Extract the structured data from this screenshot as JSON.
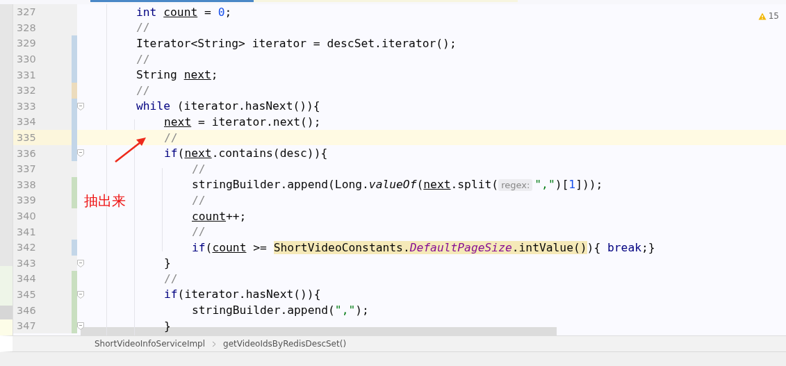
{
  "inspection": {
    "warnings": "15"
  },
  "lines": [
    {
      "number": "327",
      "fold": false,
      "current": false,
      "tokens": [
        {
          "kind": "keyword",
          "text": "int "
        },
        {
          "kind": "local",
          "text": "count"
        },
        {
          "kind": "plain",
          "text": " = "
        },
        {
          "kind": "number",
          "text": "0"
        },
        {
          "kind": "plain",
          "text": ";"
        }
      ]
    },
    {
      "number": "328",
      "fold": false,
      "current": false,
      "tokens": [
        {
          "kind": "comment",
          "text": "//"
        }
      ]
    },
    {
      "number": "329",
      "color": "#c3d6e8",
      "fold": false,
      "current": false,
      "tokens": [
        {
          "kind": "plain",
          "text": "Iterator<String> iterator = descSet.iterator();"
        }
      ]
    },
    {
      "number": "330",
      "color": "#c3d6e8",
      "fold": false,
      "current": false,
      "tokens": [
        {
          "kind": "comment",
          "text": "//"
        }
      ]
    },
    {
      "number": "331",
      "color": "#c3d6e8",
      "fold": false,
      "current": false,
      "tokens": [
        {
          "kind": "plain",
          "text": "String "
        },
        {
          "kind": "local",
          "text": "next"
        },
        {
          "kind": "plain",
          "text": ";"
        }
      ]
    },
    {
      "number": "332",
      "color": "#ecdcbd",
      "fold": false,
      "current": false,
      "tokens": [
        {
          "kind": "comment",
          "text": "//"
        }
      ]
    },
    {
      "number": "333",
      "color": "#c3d6e8",
      "fold": true,
      "current": false,
      "tokens": [
        {
          "kind": "keyword",
          "text": "while"
        },
        {
          "kind": "plain",
          "text": " (iterator.hasNext()){"
        }
      ],
      "children": [
        {
          "number": "334",
          "color": "#c3d6e8",
          "fold": false,
          "current": false,
          "tokens": [
            {
              "kind": "local",
              "text": "next"
            },
            {
              "kind": "plain",
              "text": " = iterator.next();"
            }
          ]
        },
        {
          "number": "335",
          "color": "#c3d6e8",
          "fold": false,
          "current": true,
          "tokens": [
            {
              "kind": "comment",
              "text": "//"
            }
          ]
        },
        {
          "number": "336",
          "color": "#c3d6e8",
          "fold": true,
          "current": false,
          "tokens": [
            {
              "kind": "keyword",
              "text": "if"
            },
            {
              "kind": "plain",
              "text": "("
            },
            {
              "kind": "local",
              "text": "next"
            },
            {
              "kind": "plain",
              "text": ".contains(desc)){"
            }
          ],
          "children": [
            {
              "number": "337",
              "fold": false,
              "current": false,
              "tokens": [
                {
                  "kind": "comment",
                  "text": "//"
                }
              ]
            },
            {
              "number": "338",
              "color": "#c9dfc0",
              "fold": false,
              "current": false,
              "tokens": [
                {
                  "kind": "plain",
                  "text": "stringBuilder.append(Long."
                },
                {
                  "kind": "static-method",
                  "text": "valueOf"
                },
                {
                  "kind": "plain",
                  "text": "("
                },
                {
                  "kind": "local",
                  "text": "next"
                },
                {
                  "kind": "plain",
                  "text": ".split("
                },
                {
                  "kind": "hint",
                  "text": "regex:"
                },
                {
                  "kind": "string",
                  "text": "\",\""
                },
                {
                  "kind": "plain",
                  "text": ")["
                },
                {
                  "kind": "number",
                  "text": "1"
                },
                {
                  "kind": "plain",
                  "text": "]));"
                }
              ]
            },
            {
              "number": "339",
              "color": "#c9dfc0",
              "fold": false,
              "current": false,
              "tokens": [
                {
                  "kind": "comment",
                  "text": "//"
                }
              ]
            },
            {
              "number": "340",
              "fold": false,
              "current": false,
              "tokens": [
                {
                  "kind": "local",
                  "text": "count"
                },
                {
                  "kind": "plain",
                  "text": "++;"
                }
              ]
            },
            {
              "number": "341",
              "fold": false,
              "current": false,
              "tokens": [
                {
                  "kind": "comment",
                  "text": "//"
                }
              ]
            },
            {
              "number": "342",
              "color": "#c3d6e8",
              "fold": false,
              "current": false,
              "tokens": [
                {
                  "kind": "keyword",
                  "text": "if"
                },
                {
                  "kind": "plain",
                  "text": "("
                },
                {
                  "kind": "local",
                  "text": "count"
                },
                {
                  "kind": "plain",
                  "text": " >= "
                },
                {
                  "kind": "highlight",
                  "parts": [
                    {
                      "kind": "plain",
                      "text": "ShortVideoConstants."
                    },
                    {
                      "kind": "static-field",
                      "text": "DefaultPageSize"
                    },
                    {
                      "kind": "plain",
                      "text": ".intValue()"
                    }
                  ]
                },
                {
                  "kind": "plain",
                  "text": "){ "
                },
                {
                  "kind": "keyword",
                  "text": "break"
                },
                {
                  "kind": "plain",
                  "text": ";}"
                }
              ]
            }
          ]
        },
        {
          "number": "343",
          "fold": true,
          "current": false,
          "tokens": [
            {
              "kind": "plain",
              "text": "}"
            }
          ]
        },
        {
          "number": "344",
          "color": "#c9dfc0",
          "fold": false,
          "current": false,
          "tokens": [
            {
              "kind": "comment",
              "text": "//"
            }
          ]
        },
        {
          "number": "345",
          "color": "#c9dfc0",
          "fold": true,
          "current": false,
          "tokens": [
            {
              "kind": "keyword",
              "text": "if"
            },
            {
              "kind": "plain",
              "text": "(iterator.hasNext()){"
            }
          ],
          "children": [
            {
              "number": "346",
              "color": "#c9dfc0",
              "fold": false,
              "current": false,
              "tokens": [
                {
                  "kind": "plain",
                  "text": "stringBuilder.append("
                },
                {
                  "kind": "string",
                  "text": "\",\""
                },
                {
                  "kind": "plain",
                  "text": ");"
                }
              ]
            }
          ]
        },
        {
          "number": "347",
          "color": "#c9dfc0",
          "fold": true,
          "current": false,
          "tokens": [
            {
              "kind": "plain",
              "text": "}"
            }
          ]
        }
      ]
    }
  ],
  "annotation": {
    "note": "抽出来"
  },
  "breadcrumb": [
    {
      "label": "ShortVideoInfoServiceImpl"
    },
    {
      "label": "getVideoIdsByRedisDescSet()"
    }
  ]
}
